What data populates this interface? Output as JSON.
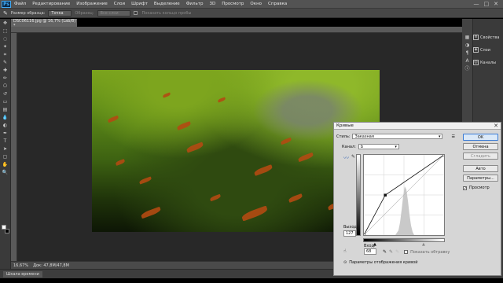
{
  "app": {
    "logo": "Ps"
  },
  "menu": [
    "Файл",
    "Редактирование",
    "Изображение",
    "Слои",
    "Шрифт",
    "Выделение",
    "Фильтр",
    "3D",
    "Просмотр",
    "Окно",
    "Справка"
  ],
  "window_controls": {
    "minimize": "—",
    "maximize": "□",
    "close": "✕"
  },
  "options_bar": {
    "sample_label": "Размер образца:",
    "sample_value": "Точка",
    "samples_label": "Образец:",
    "samples_value": "Все слои",
    "show_ring_label": "Показать кольцо пробы"
  },
  "document": {
    "tab_title": "DSC06116.jpg @ 16,7% (Lab/8) *",
    "zoom": "16,67%",
    "doc_info": "Док: 47,8M/47,8M"
  },
  "bottom_tab": {
    "label": "Шкала времени"
  },
  "right_panel": {
    "items": [
      {
        "icon": "properties-icon",
        "label": "Свойства"
      },
      {
        "icon": "layers-icon",
        "label": "Слои"
      },
      {
        "icon": "channels-icon",
        "label": "Каналы"
      }
    ]
  },
  "curves": {
    "title": "Кривые",
    "close_glyph": "✕",
    "preset_label": "Стиль:",
    "preset_value": "Заказная",
    "channel_label": "Канал:",
    "channel_value": "b",
    "output_label": "Выход:",
    "output_value": "127",
    "input_label": "Вход:",
    "input_value": "68",
    "show_clipping_label": "Показать обтравку",
    "display_options_label": "Параметры отображения кривой",
    "preview_label": "Просмотр",
    "preview_checked": true,
    "buttons": {
      "ok": "OK",
      "cancel": "Отмена",
      "smooth": "Сгладить",
      "auto": "Авто",
      "options": "Параметры..."
    },
    "curve_points": [
      [
        0,
        0
      ],
      [
        68,
        127
      ],
      [
        255,
        255
      ]
    ]
  },
  "colors": {
    "workspace": "#282828",
    "menubar": "#535353",
    "dialog": "#d6d6d6",
    "accent": "#3a7bd5"
  }
}
